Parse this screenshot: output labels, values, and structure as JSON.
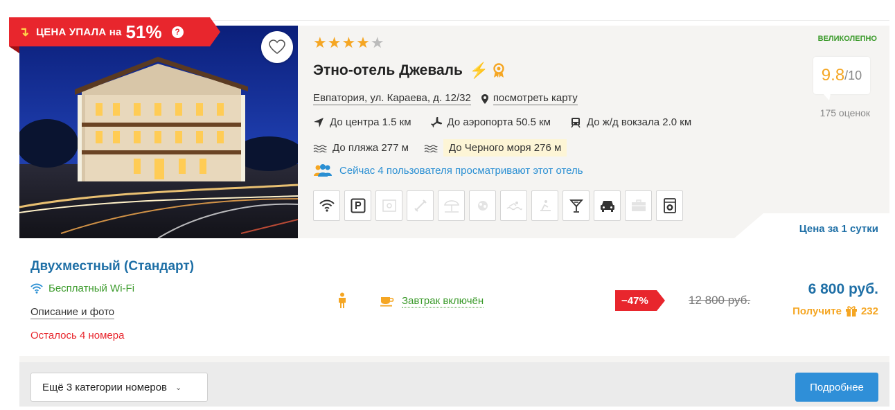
{
  "ribbon": {
    "text": "ЦЕНА УПАЛА на",
    "percent": "51%",
    "help_glyph": "?"
  },
  "hotel": {
    "stars_on": "★★★★",
    "stars_off": "★",
    "name": "Этно-отель Джеваль",
    "address": "Евпатория, ул. Караева, д. 12/32",
    "map_link": "посмотреть карту",
    "distances": [
      {
        "label": "До центра 1.5 км",
        "icon": "navigation-arrow-icon"
      },
      {
        "label": "До аэропорта 50.5 км",
        "icon": "airplane-icon"
      },
      {
        "label": "До ж/д вокзала 2.0 км",
        "icon": "train-icon"
      }
    ],
    "beach": "До пляжа 277 м",
    "sea": "До Черного моря 276 м",
    "viewers": "Сейчас 4 пользователя просматривают этот отель"
  },
  "amenities": [
    "wifi-icon",
    "parking-icon",
    "safe-icon",
    "gym-icon",
    "beach-umbrella-icon",
    "spa-icon",
    "pool-icon",
    "sauna-icon",
    "bar-icon",
    "taxi-icon",
    "business-icon",
    "laundry-icon"
  ],
  "score": {
    "word": "ВЕЛИКОЛЕПНО",
    "value": "9.8",
    "max": "/10",
    "reviews": "175 оценок"
  },
  "price_tab": "Цена за 1 сутки",
  "room": {
    "title": "Двухместный (Стандарт)",
    "wifi": "Бесплатный Wi-Fi",
    "description_link": "Описание и фото",
    "rooms_left": "Осталось 4 номера",
    "breakfast": "Завтрак включён",
    "discount": "−47%",
    "old_price": "12 800 руб.",
    "price": "6 800 руб.",
    "bonus_label": "Получите",
    "bonus_value": "232"
  },
  "footer": {
    "more_categories": "Ещё 3 категории номеров",
    "details_button": "Подробнее"
  },
  "colors": {
    "accent_red": "#e8262d",
    "link_blue": "#1e6fa6",
    "button_blue": "#2f8fd8",
    "green": "#3a9a2a",
    "orange": "#f5a623"
  }
}
